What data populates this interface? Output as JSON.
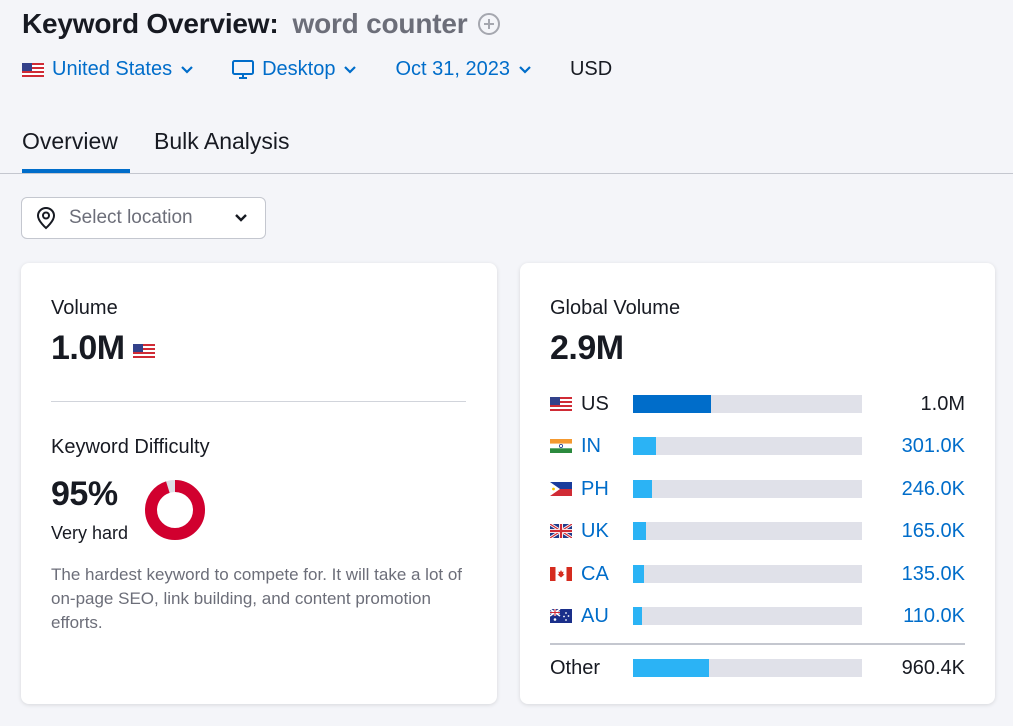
{
  "header": {
    "title": "Keyword Overview:",
    "keyword": "word counter"
  },
  "filters": {
    "country": "United States",
    "device": "Desktop",
    "date": "Oct 31, 2023",
    "currency": "USD"
  },
  "tabs": [
    "Overview",
    "Bulk Analysis"
  ],
  "location": {
    "placeholder": "Select location"
  },
  "volume_card": {
    "volume_label": "Volume",
    "volume_value": "1.0M",
    "kd_label": "Keyword Difficulty",
    "kd_value": "95%",
    "kd_percent": 95,
    "kd_rating": "Very hard",
    "kd_description": "The hardest keyword to compete for. It will take a lot of on-page SEO, link building, and content promotion efforts."
  },
  "global_card": {
    "label": "Global Volume",
    "value": "2.9M",
    "rows": [
      {
        "code": "US",
        "value": "1.0M",
        "share": 0.34,
        "flag": "us-flag"
      },
      {
        "code": "IN",
        "value": "301.0K",
        "share": 0.1,
        "flag": "india-flag"
      },
      {
        "code": "PH",
        "value": "246.0K",
        "share": 0.085,
        "flag": "philippines-flag"
      },
      {
        "code": "UK",
        "value": "165.0K",
        "share": 0.057,
        "flag": "uk-flag"
      },
      {
        "code": "CA",
        "value": "135.0K",
        "share": 0.047,
        "flag": "canada-flag"
      },
      {
        "code": "AU",
        "value": "110.0K",
        "share": 0.038,
        "flag": "australia-flag"
      }
    ],
    "other_label": "Other",
    "other_value": "960.4K",
    "other_share": 0.33
  },
  "colors": {
    "link": "#006dca",
    "bar_primary": "#006dca",
    "bar_secondary": "#2bb3f5",
    "bar_track": "#e0e1e9",
    "kd_red": "#d1002f",
    "kd_track": "#dedfe6"
  }
}
